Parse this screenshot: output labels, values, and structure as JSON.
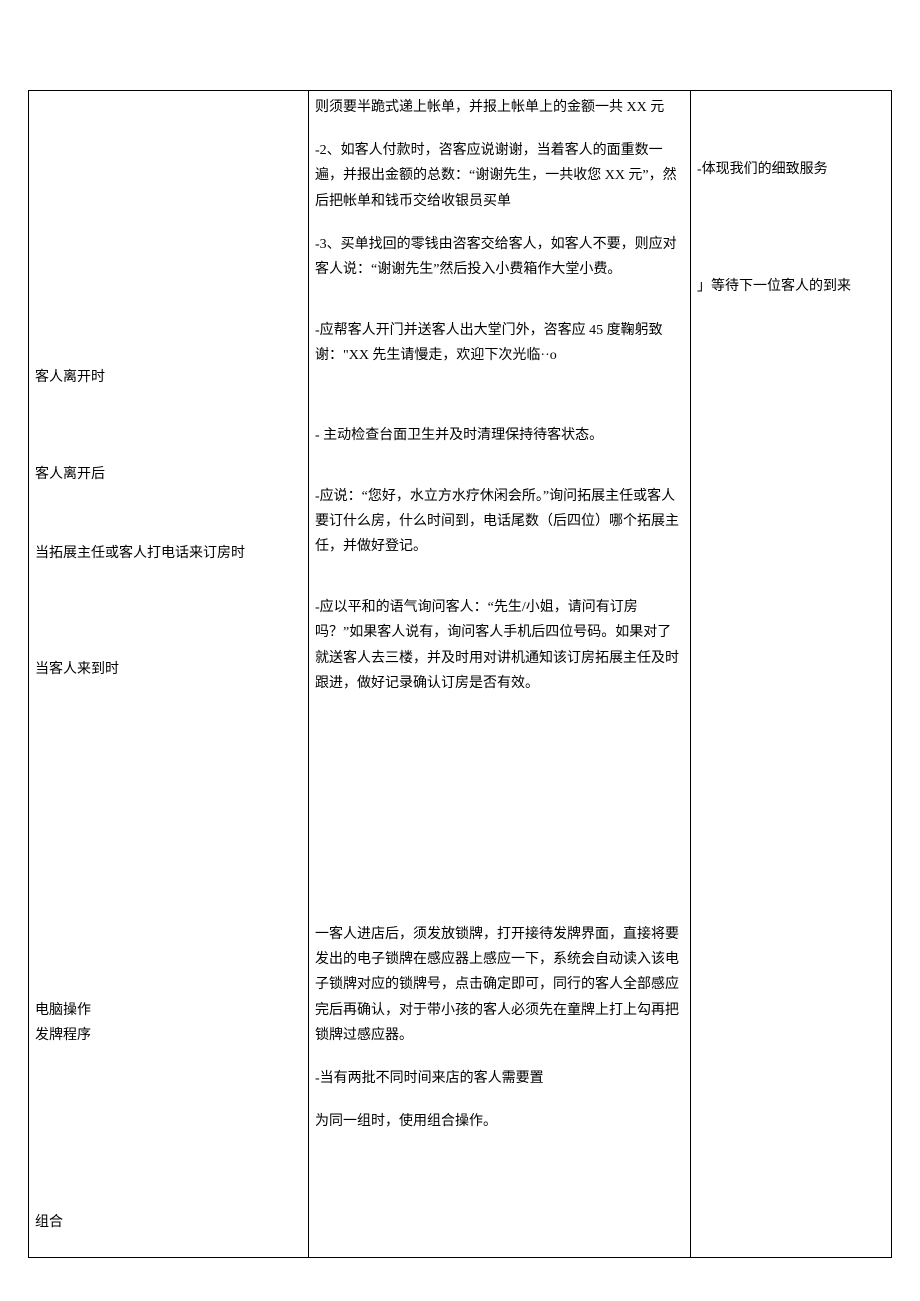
{
  "col2": {
    "p1": "则须要半跪式递上帐单，并报上帐单上的金额一共 XX 元",
    "p2": "-2、如客人付款时，咨客应说谢谢，当着客人的面重数一遍，并报出金额的总数：“谢谢先生，一共收您 XX 元”，然后把帐单和钱币交给收银员买单",
    "p3": "-3、买单找回的零钱由咨客交给客人，如客人不要，则应对客人说：“谢谢先生”然后投入小费箱作大堂小费。"
  },
  "col3": {
    "n1": "-体现我们的细致服务",
    "n2": "」等待下一位客人的到来"
  },
  "rows": {
    "leave": {
      "label": "客人离开时",
      "text": "-应帮客人开门并送客人出大堂门外，咨客应 45 度鞠躬致谢：\"XX 先生请慢走，欢迎下次光临··o"
    },
    "after": {
      "label": "客人离开后",
      "text": "- 主动检查台面卫生并及时清理保持待客状态。"
    },
    "phone": {
      "label": "当拓展主任或客人打电话来订房时",
      "text": "-应说：“您好，水立方水疗休闲会所。”询问拓展主任或客人要订什么房，什么时间到，电话尾数（后四位）哪个拓展主任，并做好登记。"
    },
    "arrive": {
      "label": "当客人来到时",
      "text": "-应以平和的语气询问客人：“先生/小姐，请问有订房吗？”如果客人说有，询问客人手机后四位号码。如果对了就送客人去三楼，并及时用对讲机通知该订房拓展主任及时跟进，做好记录确认订房是否有效。"
    },
    "computer": {
      "label1": "电脑操作",
      "label2": "发牌程序",
      "p1": "一客人进店后，须发放锁牌，打开接待发牌界面，直接将要发出的电子锁牌在感应器上感应一下，系统会自动读入该电子锁牌对应的锁牌号，点击确定即可，同行的客人全部感应完后再确认，对于带小孩的客人必须先在童牌上打上勾再把锁牌过感应器。",
      "p2": "-当有两批不同时间来店的客人需要置"
    },
    "combine": {
      "label": "组合",
      "text": "为同一组时，使用组合操作。"
    }
  }
}
